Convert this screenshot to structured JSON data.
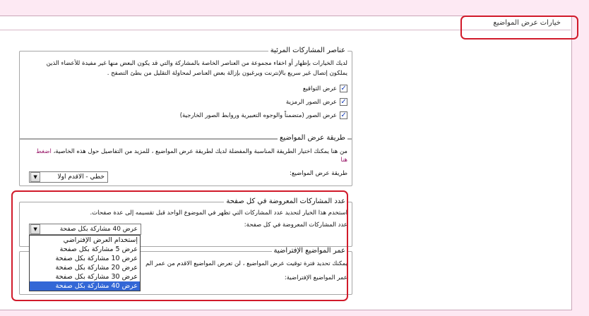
{
  "header": {
    "title": "خيارات عرض المواضيع"
  },
  "visible_elements": {
    "legend": "عناصر المشاركات المرئية",
    "description_line1": "لديك الخيارات بإظهار أو اخفاء مجموعة من العناصر الخاصة بالمشاركة والتي قد يكون البعض منها غير مفيدة للأعضاء الذين",
    "description_line2": "يملكون إتصال غير سريع بالإنترنت ويرغبون بإزالة بعض العناصر لمحاولة التقليل من بطئ التصفح .",
    "options": [
      {
        "label": "عرض التواقيع",
        "checked": true
      },
      {
        "label": "عرض الصور الرمزية",
        "checked": true
      },
      {
        "label": "عرض الصور (متضمناً والوجوه التعبيرية وروابط الصور الخارجية)",
        "checked": true
      }
    ]
  },
  "display_mode": {
    "legend": "طريقة عرض المواضيع",
    "description": "من هنا يمكنك اختيار الطريقة المناسبة والمفضلة لديك لطريقة عرض المواضيع ، للمزيد من التفاصيل حول هذه الخاصية،",
    "link_text": "اضغط",
    "link_text2": "هنا",
    "select_label": "طريقة عرض المواضيع:",
    "select_value": "خطي - الأقدم أولاً"
  },
  "posts_per_page": {
    "legend": "عدد المشاركات المعروضة في كل صفحة",
    "description": "استخدم هذا الخيار لتحديد عدد المشاركات التي تظهر في الموضوع الواحد قبل تقسيمه إلى عدة صفحات.",
    "select_label": "عدد المشاركات المعروضة في كل صفحة:",
    "select_value": "عرض 40 مشاركة بكل صفحة",
    "options": [
      "إستخدام العرض الإفتراضي",
      "عرض 5 مشاركة بكل صفحة",
      "عرض 10 مشاركة بكل صفحة",
      "عرض 20 مشاركة بكل صفحة",
      "عرض 30 مشاركة بكل صفحة",
      "عرض 40 مشاركة بكل صفحة"
    ],
    "selected_index": 5
  },
  "default_age": {
    "legend": "عمر المواضيع الإفتراضية",
    "description": "يمكنك تحديد فترة توقيت عرض المواضيع ، لن تعرض المواضيع الاقدم من عمر الم",
    "select_label": "عمر المواضيع الإفتراضية:"
  },
  "colors": {
    "highlight_outline": "#d11a2a",
    "selected_option": "#3367d6",
    "page_background": "#fde9f3"
  },
  "icons": {
    "checkbox": "checkmark-icon",
    "dropdown": "dropdown-arrow-icon"
  }
}
